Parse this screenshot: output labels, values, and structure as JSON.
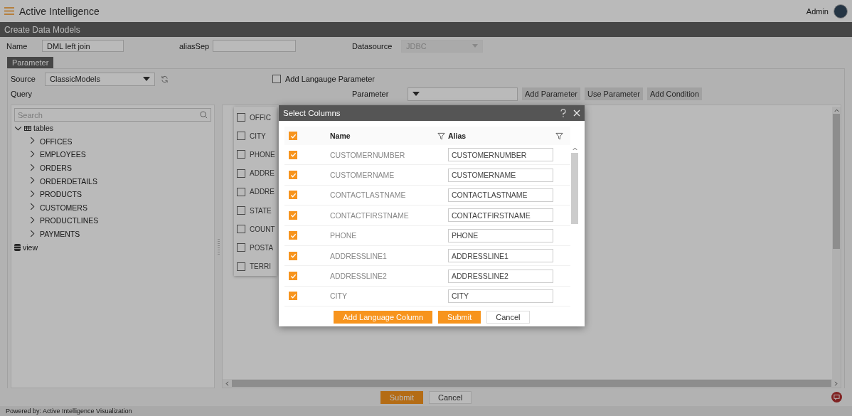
{
  "header": {
    "title": "Active Intelligence",
    "user": "Admin"
  },
  "page_title": "Create Data Models",
  "form": {
    "name_label": "Name",
    "name_value": "DML left join",
    "alias_label": "aliasSep",
    "datasource_label": "Datasource",
    "datasource_value": "JDBC",
    "datasource_disabled": true
  },
  "tab": {
    "label": "Parameter",
    "selected": true
  },
  "source": {
    "label": "Source",
    "value": "ClassicModels"
  },
  "language_param": {
    "label": "Add Langauge Parameter",
    "checked": false
  },
  "query_label": "Query",
  "parameter": {
    "label": "Parameter"
  },
  "parameter_buttons": [
    "Add Parameter",
    "Use Parameter",
    "Add Condition"
  ],
  "tree": {
    "search_placeholder": "Search",
    "nodes": [
      {
        "kind": "group",
        "label": "tables",
        "expanded": true,
        "children": [
          {
            "label": "OFFICES",
            "expanded": false
          },
          {
            "label": "EMPLOYEES",
            "expanded": false
          },
          {
            "label": "ORDERS",
            "expanded": false
          },
          {
            "label": "ORDERDETAILS",
            "expanded": false
          },
          {
            "label": "PRODUCTS",
            "expanded": false
          },
          {
            "label": "CUSTOMERS",
            "expanded": false
          },
          {
            "label": "PRODUCTLINES",
            "expanded": false
          },
          {
            "label": "PAYMENTS",
            "expanded": false
          }
        ]
      },
      {
        "kind": "view",
        "label": "view"
      }
    ]
  },
  "column_list": [
    {
      "label": "OFFIC",
      "checked": false
    },
    {
      "label": "CITY",
      "checked": false
    },
    {
      "label": "PHONE",
      "checked": false
    },
    {
      "label": "ADDRE",
      "checked": false
    },
    {
      "label": "ADDRE",
      "checked": false
    },
    {
      "label": "STATE",
      "checked": false
    },
    {
      "label": "COUNT",
      "checked": false
    },
    {
      "label": "POSTA",
      "checked": false
    },
    {
      "label": "TERRI",
      "checked": false
    }
  ],
  "dialog": {
    "title": "Select Columns",
    "columns": [
      "Name",
      "Alias"
    ],
    "all_checked": true,
    "rows": [
      {
        "name": "CUSTOMERNUMBER",
        "alias": "CUSTOMERNUMBER",
        "checked": true
      },
      {
        "name": "CUSTOMERNAME",
        "alias": "CUSTOMERNAME",
        "checked": true
      },
      {
        "name": "CONTACTLASTNAME",
        "alias": "CONTACTLASTNAME",
        "checked": true
      },
      {
        "name": "CONTACTFIRSTNAME",
        "alias": "CONTACTFIRSTNAME",
        "checked": true
      },
      {
        "name": "PHONE",
        "alias": "PHONE",
        "checked": true
      },
      {
        "name": "ADDRESSLINE1",
        "alias": "ADDRESSLINE1",
        "checked": true
      },
      {
        "name": "ADDRESSLINE2",
        "alias": "ADDRESSLINE2",
        "checked": true
      },
      {
        "name": "CITY",
        "alias": "CITY",
        "checked": true
      }
    ],
    "buttons": [
      {
        "label": "Add Language Column",
        "kind": "primary"
      },
      {
        "label": "Submit",
        "kind": "primary"
      },
      {
        "label": "Cancel",
        "kind": "secondary"
      }
    ]
  },
  "bottom_buttons": [
    {
      "label": "Submit",
      "kind": "primary"
    },
    {
      "label": "Cancel",
      "kind": "secondary"
    }
  ],
  "footer": "Powered by: Active Intelligence Visualization"
}
